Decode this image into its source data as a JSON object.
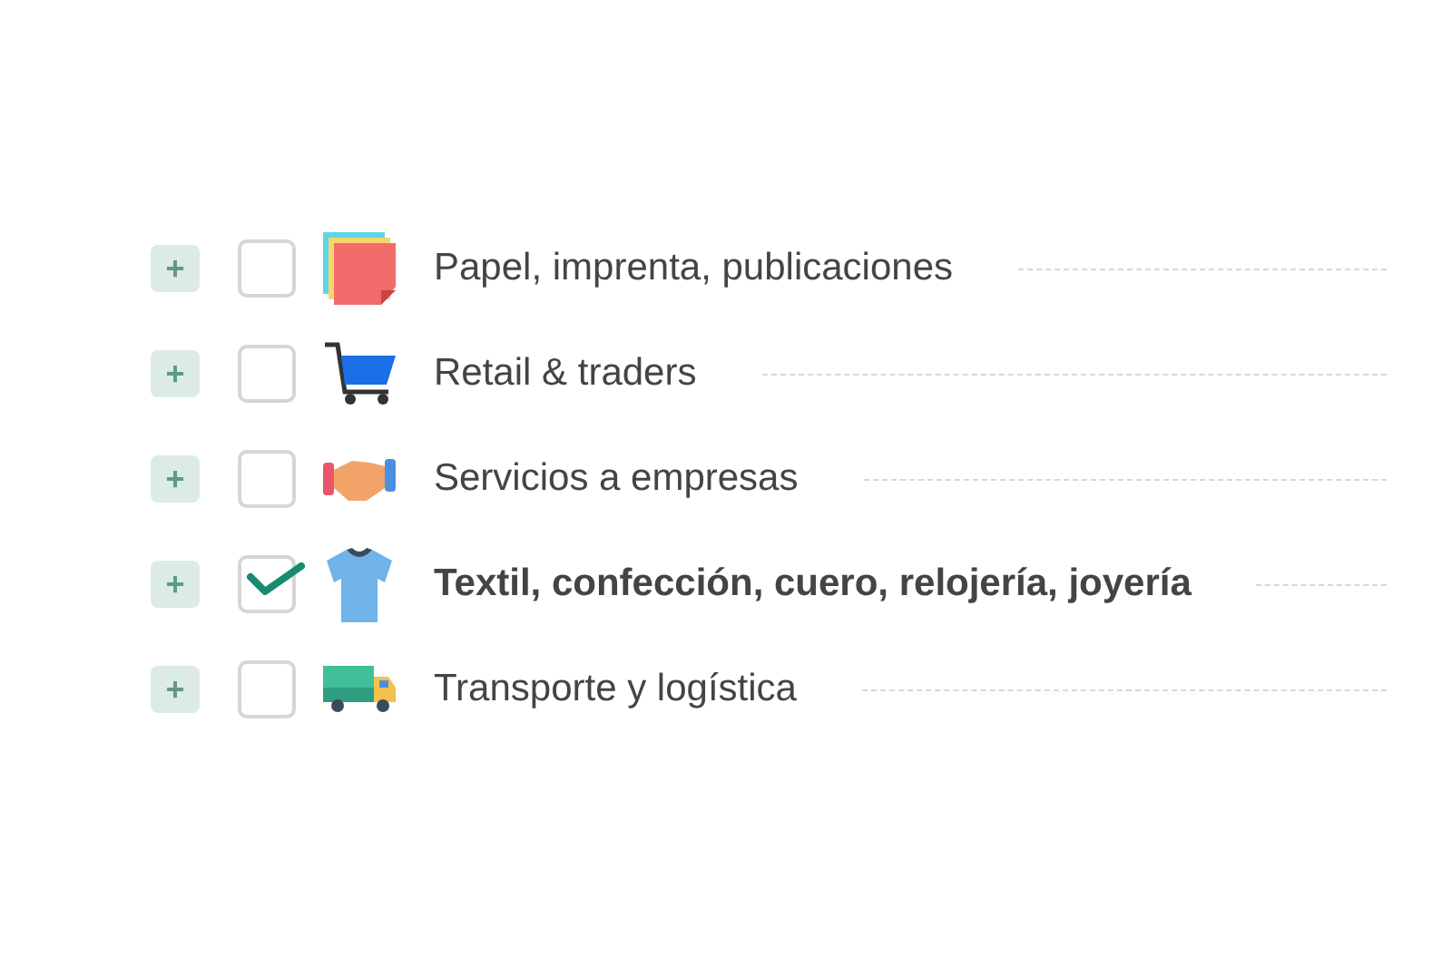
{
  "categories": [
    {
      "expand": "+",
      "label": "Papel, imprenta, publicaciones",
      "checked": false,
      "kind": "paper"
    },
    {
      "expand": "+",
      "label": "Retail & traders",
      "checked": false,
      "kind": "cart"
    },
    {
      "expand": "+",
      "label": "Servicios a empresas",
      "checked": false,
      "kind": "handshake"
    },
    {
      "expand": "+",
      "label": "Textil, confección, cuero, relojería, joyería",
      "checked": true,
      "kind": "shirt"
    },
    {
      "expand": "+",
      "label": "Transporte y logística",
      "checked": false,
      "kind": "truck"
    }
  ]
}
